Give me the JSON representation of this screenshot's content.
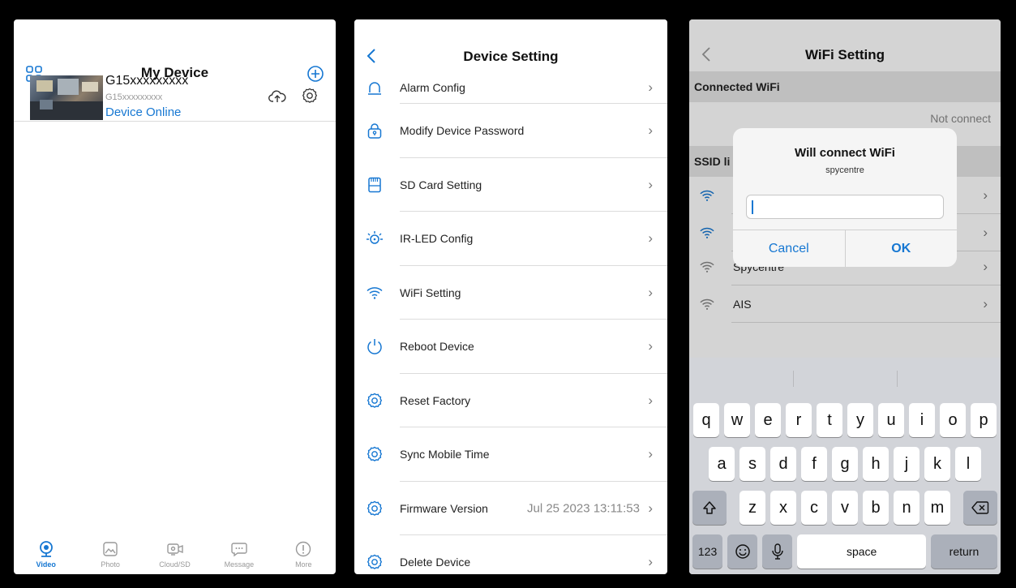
{
  "screen1": {
    "title": "My Device",
    "device": {
      "name": "G15xxxxxxxxx",
      "id": "G15xxxxxxxxx",
      "status": "Device Online"
    },
    "tabs": [
      {
        "label": "Video",
        "icon": "camera-icon",
        "active": true
      },
      {
        "label": "Photo",
        "icon": "photo-icon",
        "active": false
      },
      {
        "label": "Cloud/SD",
        "icon": "cloud-sd-icon",
        "active": false
      },
      {
        "label": "Message",
        "icon": "message-icon",
        "active": false
      },
      {
        "label": "More",
        "icon": "more-icon",
        "active": false
      }
    ]
  },
  "screen2": {
    "title": "Device Setting",
    "items": [
      {
        "label": "Alarm Config",
        "icon": "alarm-icon",
        "value": ""
      },
      {
        "label": "Modify Device Password",
        "icon": "lock-icon",
        "value": ""
      },
      {
        "label": "SD Card Setting",
        "icon": "sd-card-icon",
        "value": ""
      },
      {
        "label": "IR-LED Config",
        "icon": "ir-led-icon",
        "value": ""
      },
      {
        "label": "WiFi Setting",
        "icon": "wifi-icon",
        "value": ""
      },
      {
        "label": "Reboot Device",
        "icon": "power-icon",
        "value": ""
      },
      {
        "label": "Reset Factory",
        "icon": "gear-icon",
        "value": ""
      },
      {
        "label": "Sync Mobile Time",
        "icon": "gear-icon",
        "value": ""
      },
      {
        "label": "Firmware Version",
        "icon": "gear-icon",
        "value": "Jul 25 2023 13:11:53"
      },
      {
        "label": "Delete Device",
        "icon": "gear-icon",
        "value": ""
      }
    ]
  },
  "screen3": {
    "title": "WiFi Setting",
    "connected_header": "Connected WiFi",
    "connected_value": "Not connect",
    "ssid_header": "SSID li",
    "networks": [
      "",
      "",
      "Spycentre",
      "AIS"
    ],
    "dialog": {
      "title": "Will connect WiFi",
      "subtitle": "spycentre",
      "input_value": "",
      "cancel": "Cancel",
      "ok": "OK"
    },
    "keyboard": {
      "row1": [
        "q",
        "w",
        "e",
        "r",
        "t",
        "y",
        "u",
        "i",
        "o",
        "p"
      ],
      "row2": [
        "a",
        "s",
        "d",
        "f",
        "g",
        "h",
        "j",
        "k",
        "l"
      ],
      "row3": [
        "z",
        "x",
        "c",
        "v",
        "b",
        "n",
        "m"
      ],
      "numbers": "123",
      "space": "space",
      "return": "return"
    }
  },
  "colors": {
    "accent": "#1677d2",
    "divider": "#dcdcdc",
    "keyboard_bg": "#d2d4d9"
  }
}
